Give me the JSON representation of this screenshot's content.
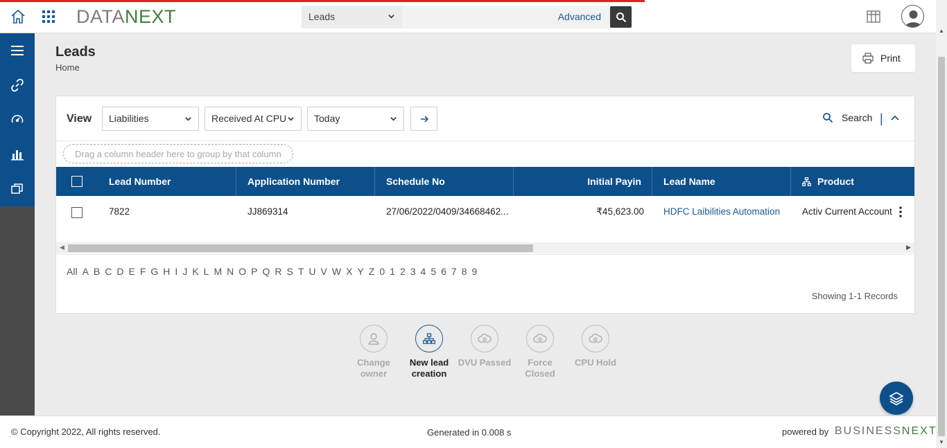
{
  "logo": {
    "part1": "DATA",
    "part2": "NEXT"
  },
  "search": {
    "entity": "Leads",
    "advanced": "Advanced"
  },
  "page": {
    "title": "Leads",
    "breadcrumb": "Home",
    "print": "Print"
  },
  "view": {
    "label": "View",
    "filter1": "Liabilities",
    "filter2": "Received At CPU",
    "filter3": "Today",
    "search": "Search"
  },
  "grid": {
    "group_hint": "Drag a column header here to group by that column",
    "columns": [
      "Lead Number",
      "Application Number",
      "Schedule No",
      "Initial Payin",
      "Lead Name",
      "Product"
    ],
    "rows": [
      {
        "lead_number": "7822",
        "application_number": "JJ869314",
        "schedule_no": "27/06/2022/0409/34668462...",
        "initial_payin": "₹45,623.00",
        "lead_name": "HDFC Laibilities Automation",
        "product": "Activ Current Account"
      }
    ],
    "alphabet": [
      "All",
      "A",
      "B",
      "C",
      "D",
      "E",
      "F",
      "G",
      "H",
      "I",
      "J",
      "K",
      "L",
      "M",
      "N",
      "O",
      "P",
      "Q",
      "R",
      "S",
      "T",
      "U",
      "V",
      "W",
      "X",
      "Y",
      "Z",
      "0",
      "1",
      "2",
      "3",
      "4",
      "5",
      "6",
      "7",
      "8",
      "9"
    ],
    "records": "Showing 1-1 Records"
  },
  "actions": [
    {
      "line1": "Change",
      "line2": "owner",
      "active": false
    },
    {
      "line1": "New lead",
      "line2": "creation",
      "active": true
    },
    {
      "line1": "DVU Passed",
      "line2": "",
      "active": false
    },
    {
      "line1": "Force",
      "line2": "Closed",
      "active": false
    },
    {
      "line1": "CPU Hold",
      "line2": "",
      "active": false
    }
  ],
  "footer": {
    "copyright": "© Copyright 2022, All rights reserved.",
    "generated": "Generated in 0.008 s",
    "powered_by": "powered by",
    "brand1": "BUSINESS",
    "brand2": "NEXT"
  },
  "colors": {
    "primary": "#0d4f8b",
    "sidebar": "#4a4a4a",
    "progress": "#e31e24",
    "logo_green": "#3e7e3a"
  }
}
